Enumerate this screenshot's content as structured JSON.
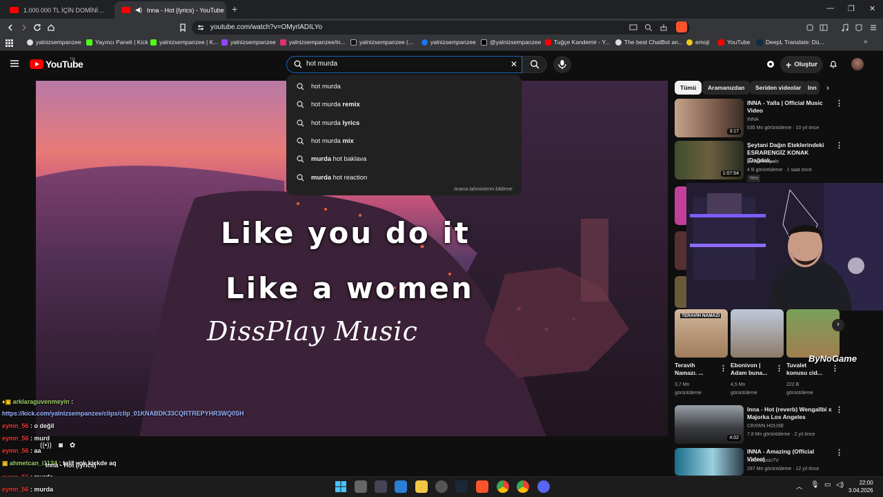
{
  "browser": {
    "tabs": [
      {
        "title": "1.000.000 TL İÇİN DOMİNİK'TE YARIŞ"
      },
      {
        "title": "Inna - Hot (lyrics) - YouTube"
      }
    ],
    "url": "youtube.com/watch?v=OMyrlADILYo",
    "bookmarks": [
      "yalnizsempanzee",
      "Yayıncı Paneli | Kick",
      "yalnizsempanzee | K...",
      "yalnizsempanzee",
      "yalnizsempanzee/in...",
      "yalnizsempanzee (...",
      "yalnizsempanzee",
      "@yalnizsempanzee",
      "Tuğçe Kandemir - Y...",
      "The best ChatBot an...",
      "emoji",
      "YouTube",
      "DeepL Translate: Dü..."
    ]
  },
  "youtube": {
    "logo_text": "YouTube",
    "country_code": "TR",
    "search_value": "hot murda",
    "create_label": "Oluştur",
    "suggestions": [
      {
        "bold": "",
        "plain": "hot murda"
      },
      {
        "bold": "",
        "plain": "hot murda remix",
        "bold_suffix": true
      },
      {
        "bold": "",
        "plain": "hot murda lyrics",
        "bold_suffix": true
      },
      {
        "bold": "",
        "plain": "hot murda mix",
        "bold_suffix": true
      },
      {
        "bold": "murda",
        "plain": " hot baklava"
      },
      {
        "bold": "murda",
        "plain": " hot reaction"
      }
    ],
    "suggestion_texts": [
      "hot murda",
      "hot murda remix",
      "hot murda lyrics",
      "hot murda mix",
      "murda hot baklava",
      "murda hot reaction"
    ],
    "suggestions_note": "Arama tahminlerini bildirme",
    "chips": [
      "Tümü",
      "Aramanızdan",
      "Seriden videolar",
      "Inn"
    ]
  },
  "video": {
    "lyric_line1": "Like you do it",
    "lyric_line2": "Like a women",
    "brand": "DissPlay Music"
  },
  "recommendations": [
    {
      "title": "INNA - Yalla | Official Music Video",
      "channel": "INNA",
      "meta": "535 Mn görüntüleme · 10 yıl önce",
      "duration": "3:17"
    },
    {
      "title": "Şeytani Dağın Eteklerindeki ESRARENGİZ KONAK (Dağdak...",
      "channel": "Nova Prospekt",
      "meta": "4 B görüntüleme · 1 saat önce",
      "duration": "1:07:54",
      "badge": "Yeni"
    },
    {
      "title": "Inna - Hot (reverb) Wengallbi x Majorka Los Angeles",
      "channel": "CRXWN HOUSE",
      "meta": "7,8 Mn görüntüleme · 2 yıl önce",
      "duration": "4:02"
    },
    {
      "title": "INNA - Amazing (Official Video)",
      "channel": "RotonMusicTV",
      "meta": "297 Mn görüntüleme · 12 yıl önce",
      "duration": ""
    }
  ],
  "shorts": [
    {
      "title": "Teravih Namazı. ...",
      "views": "3,7 Mn",
      "views_label": "görüntüleme",
      "thumb_text": "TERAVİH NAMAZI"
    },
    {
      "title": "Ebonivon | Adam buna...",
      "views": "4,5 Mn",
      "views_label": "görüntüleme"
    },
    {
      "title": "Tuvalet konusu cid...",
      "views": "222 B",
      "views_label": "görüntüleme"
    }
  ],
  "overlay": {
    "watermark": "ByNoGame",
    "chat": [
      {
        "user": "arklaraguvenmeyin",
        "text": " :"
      },
      {
        "user": "",
        "text": "https://kick.com/yalnizsempanzee/clips/clip_01KNABDK33CQRTREPYHR3WQ0SH"
      },
      {
        "user": "eymn_56",
        "text": ": o değil"
      },
      {
        "user": "eymn_56",
        "text": ": murd"
      },
      {
        "user": "eymn_56",
        "text": ": aa"
      },
      {
        "user": "ahmetcan_i1124",
        "text": ": telif yok kickde aq"
      },
      {
        "user": "eymn_56",
        "text": ": murda"
      },
      {
        "user": "eymn_56",
        "text": ": murda"
      }
    ],
    "now_playing": "Inna - Hot (lyrics)"
  },
  "taskbar": {
    "time": "22:00",
    "date": "3.04.2026"
  },
  "colors": {
    "accent_red": "#ff0000",
    "search_border": "#1c62b9",
    "background": "#0f0f0f"
  }
}
